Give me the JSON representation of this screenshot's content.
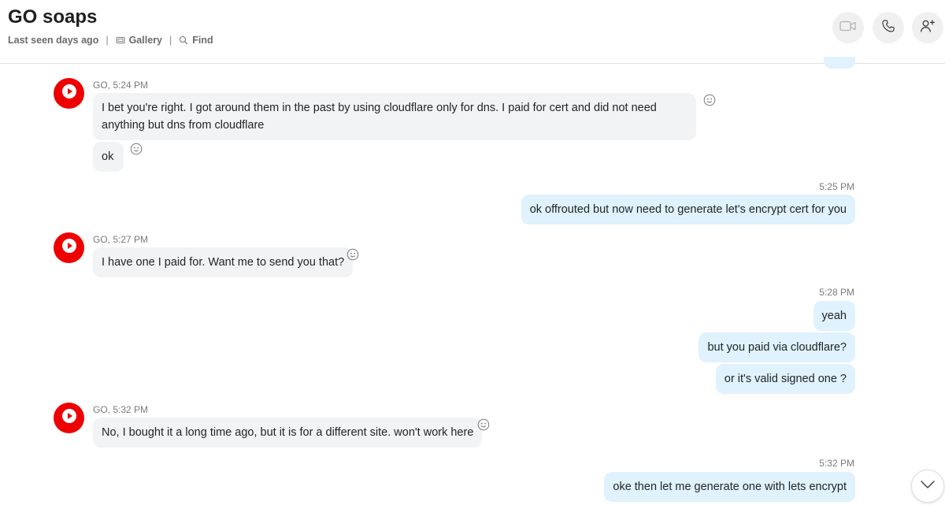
{
  "header": {
    "title": "GO soaps",
    "status": "Last seen days ago",
    "separator": "|",
    "gallery_label": "Gallery",
    "find_label": "Find",
    "buttons": [
      "video-call",
      "audio-call",
      "add-people"
    ]
  },
  "messages": [
    {
      "sender": "GO",
      "meta": "GO, 5:24 PM",
      "text": "I bet you're right. I got around them in the past by using cloudflare only for dns. I paid for cert and did not need anything but dns from cloudflare"
    },
    {
      "sender": "GO",
      "text": "ok"
    },
    {
      "sender": "me",
      "meta": "5:25 PM",
      "text": "ok offrouted but now need to generate let's encrypt cert for you"
    },
    {
      "sender": "GO",
      "meta": "GO, 5:27 PM",
      "text": "I have one I paid for. Want me to send you that?"
    },
    {
      "sender": "me",
      "meta": "5:28 PM",
      "text": "yeah"
    },
    {
      "sender": "me",
      "text": "but you paid via cloudflare?"
    },
    {
      "sender": "me",
      "text": "or it's valid signed one ?"
    },
    {
      "sender": "GO",
      "meta": "GO, 5:32 PM",
      "text": "No, I bought it a long time ago, but it is for a different site. won't work here"
    },
    {
      "sender": "me",
      "meta": "5:32 PM",
      "text": "oke then let me generate one with lets encrypt"
    }
  ],
  "colors": {
    "incoming_bubble": "#f2f3f5",
    "outgoing_bubble": "#dff2fd",
    "avatar": "#ee0000"
  }
}
